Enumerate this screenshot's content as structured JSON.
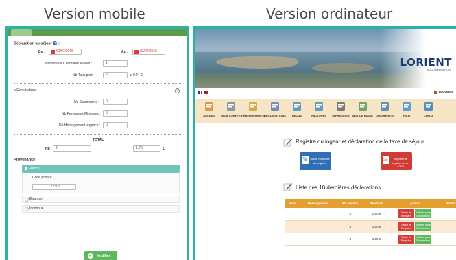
{
  "headings": {
    "mobile": "Version mobile",
    "desktop": "Version ordinateur"
  },
  "mobile": {
    "declaration_label": "Déclaration au séjour",
    "du_label": "Du :",
    "du_value": "01/07/2015",
    "au_label": "Au :",
    "au_value": "03/07/2015",
    "chambres_label": "Nombre de Chambres louées :",
    "chambres_value": "1",
    "taux_label": "Nb Taux plein :",
    "taux_value": "2",
    "taux_note": "x 0.44 €",
    "exonerations_label": "> Exonérations",
    "saisonniers_label": "Nb Saisonniers :",
    "saisonniers_value": "0",
    "mineures_label": "Nb Personnes Mineures :",
    "mineures_value": "0",
    "urgence_label": "Nb Hébergement urgence :",
    "urgence_value": "0",
    "total_label": "TOTAL",
    "nb_label": "Nb :",
    "nb_value": "2",
    "total_value": "1.76",
    "currency": "€",
    "provenance_label": "Provenance",
    "france_label": "France",
    "code_postal_label": "Code postal :",
    "code_postal_value": "22300",
    "etranger_label": "Etranger",
    "inconnue_label": "Inconnue",
    "submit_label": "Modifier"
  },
  "desktop": {
    "logo": "LORIENT",
    "logo_sub": "AGGLOMÉRATION",
    "logout_label": "Déconne",
    "nav": [
      {
        "label": "ACCUEIL",
        "icon": "handshake-icon",
        "color": "#d9893a"
      },
      {
        "label": "MON COMPTE",
        "icon": "account-icon",
        "color": "#7a8a9a"
      },
      {
        "label": "HÉBERGEMENTS",
        "icon": "house-icon",
        "color": "#c9a23a"
      },
      {
        "label": "DÉCLARATIONS",
        "icon": "pen-icon",
        "color": "#5a7fb0"
      },
      {
        "label": "RECUS",
        "icon": "receipt-icon",
        "color": "#4a90c0"
      },
      {
        "label": "FACTURES",
        "icon": "invoice-icon",
        "color": "#4a90c0"
      },
      {
        "label": "IMPRESSION",
        "icon": "printer-icon",
        "color": "#666666"
      },
      {
        "label": "MOT DE PASSE",
        "icon": "password-icon",
        "color": "#5a9a5a"
      },
      {
        "label": "DOCUMENTS",
        "icon": "documents-icon",
        "color": "#4a7fb0"
      },
      {
        "label": "F.A.Q",
        "icon": "faq-icon",
        "color": "#4a8fd0"
      },
      {
        "label": "CONTA",
        "icon": "contact-icon",
        "color": "#3a80c0"
      }
    ],
    "registre_title": "Registre du logeur et déclaration de la taxe de séjour",
    "saisie_tile": "Saisie manuelle du registre",
    "import_tile": "Importer le registre fichier .CSV",
    "list_title": "Liste des 10 dernières déclarations",
    "table": {
      "headers": [
        "Mois",
        "Hébergement",
        "Nb nuitées",
        "Montant",
        "Action",
        "Statut"
      ],
      "rows": [
        {
          "mois": "",
          "hebergement": "",
          "nuitees": "5",
          "montant": "2.50 €",
          "statut": ""
        },
        {
          "mois": "",
          "hebergement": "",
          "nuitees": "3",
          "montant": "1.50 €",
          "statut": ""
        },
        {
          "mois": "",
          "hebergement": "",
          "nuitees": "3",
          "montant": "1.50 €",
          "statut": ""
        }
      ],
      "action_red": "Saisir le Registre",
      "action_green": "Valider pour Déclaration"
    }
  }
}
